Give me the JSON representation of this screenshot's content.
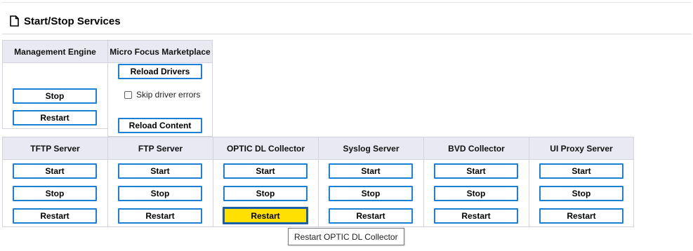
{
  "page": {
    "title": "Start/Stop Services"
  },
  "management_engine": {
    "header": "Management Engine",
    "stop": "Stop",
    "restart": "Restart"
  },
  "marketplace": {
    "header": "Micro Focus Marketplace",
    "reload_drivers": "Reload Drivers",
    "skip_driver_errors": "Skip driver errors",
    "skip_driver_errors_checked": false,
    "reload_content": "Reload Content"
  },
  "services": [
    {
      "header": "TFTP Server",
      "start": "Start",
      "stop": "Stop",
      "restart": "Restart"
    },
    {
      "header": "FTP Server",
      "start": "Start",
      "stop": "Stop",
      "restart": "Restart"
    },
    {
      "header": "OPTIC DL Collector",
      "start": "Start",
      "stop": "Stop",
      "restart": "Restart"
    },
    {
      "header": "Syslog Server",
      "start": "Start",
      "stop": "Stop",
      "restart": "Restart"
    },
    {
      "header": "BVD Collector",
      "start": "Start",
      "stop": "Stop",
      "restart": "Restart"
    },
    {
      "header": "UI Proxy Server",
      "start": "Start",
      "stop": "Stop",
      "restart": "Restart"
    }
  ],
  "tooltip": {
    "text": "Restart OPTIC DL Collector"
  },
  "colors": {
    "button_border": "#1c7fd8",
    "hover_fill": "#ffe000",
    "header_bg": "#e9e9f3"
  }
}
